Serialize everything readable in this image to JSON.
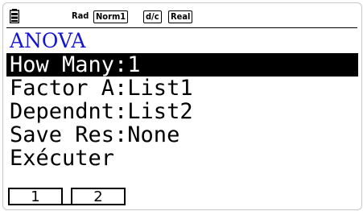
{
  "status_bar": {
    "battery_icon": "battery-icon",
    "angle": "Rad",
    "display": "Norm1",
    "fraction": "d/c",
    "complex": "Real"
  },
  "title": "ANOVA",
  "rows": [
    {
      "text": "How Many:1",
      "selected": true
    },
    {
      "text": "Factor A:List1",
      "selected": false
    },
    {
      "text": "Dependnt:List2",
      "selected": false
    },
    {
      "text": "Save Res:None",
      "selected": false
    },
    {
      "text": "Exécuter",
      "selected": false
    }
  ],
  "function_keys": [
    {
      "label": "1"
    },
    {
      "label": "2"
    }
  ],
  "colors": {
    "title": "#1515d0",
    "selection": "#000000"
  }
}
